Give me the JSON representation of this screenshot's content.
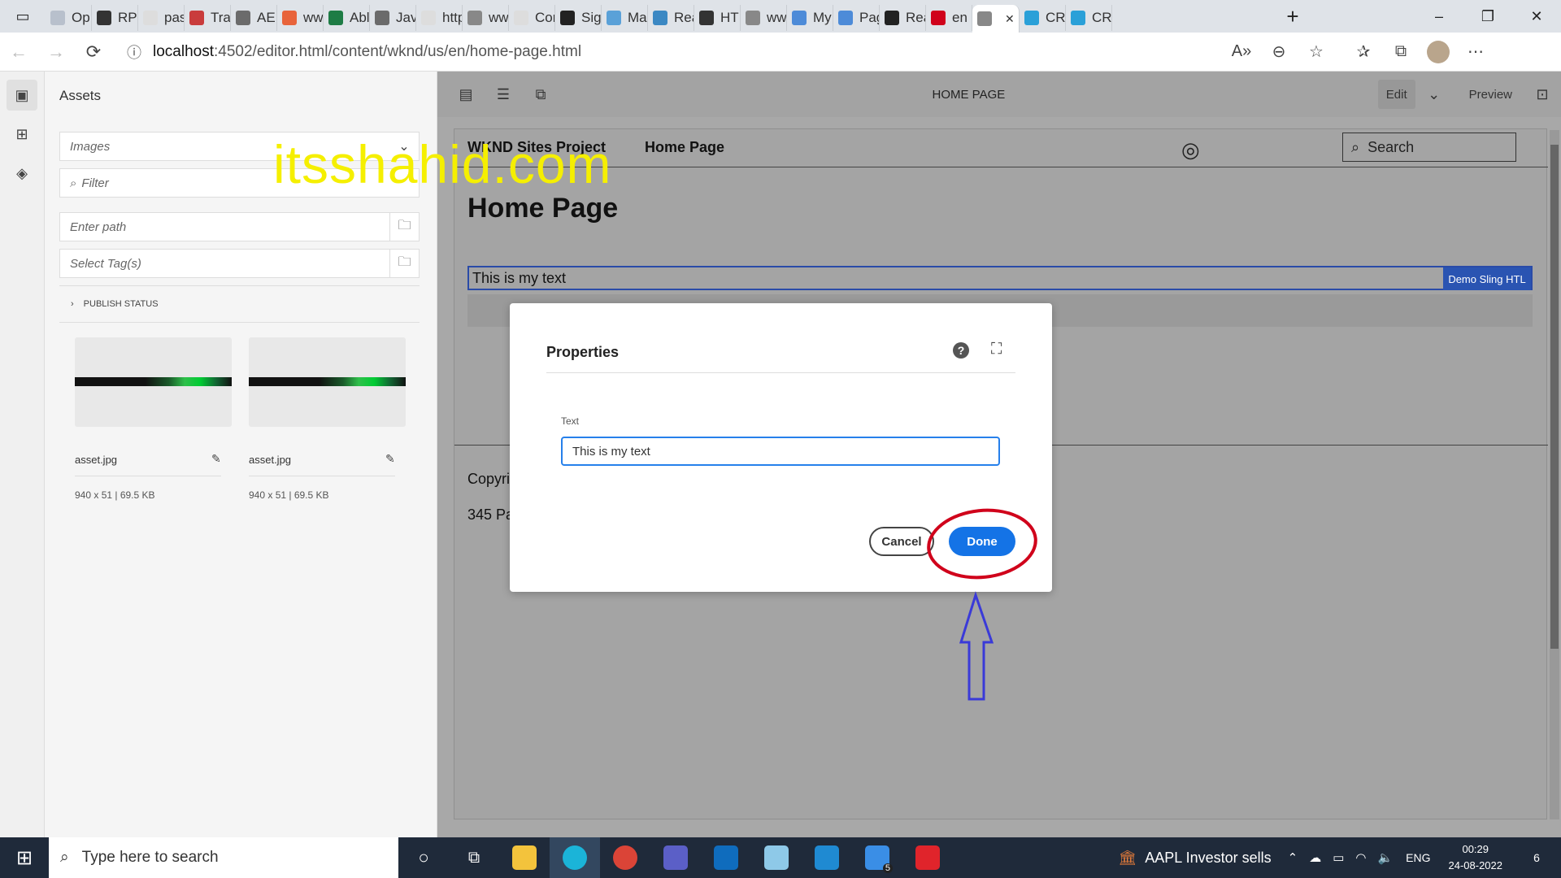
{
  "browser": {
    "tabs": [
      "Op",
      "RP-",
      "pas",
      "Trai",
      "AEN",
      "ww",
      "Abl",
      "Jav",
      "http",
      "ww",
      "Cor",
      "Sig",
      "Ma",
      "Rea",
      "HTI",
      "ww",
      "My",
      "Pag",
      "Rea",
      "en",
      "",
      "CR",
      "CR"
    ],
    "url_prefix": "localhost",
    "url_rest": ":4502/editor.html/content/wknd/us/en/home-page.html"
  },
  "assets_panel": {
    "title": "Assets",
    "type_select": "Images",
    "filter_placeholder": "Filter",
    "path_placeholder": "Enter path",
    "tags_placeholder": "Select Tag(s)",
    "publish_status": "PUBLISH STATUS",
    "items": [
      {
        "name": "asset.jpg",
        "meta": "940 x 51 | 69.5 KB"
      },
      {
        "name": "asset.jpg",
        "meta": "940 x 51 | 69.5 KB"
      }
    ]
  },
  "watermark": "itsshahid.com",
  "editor": {
    "page_title": "HOME PAGE",
    "mode": "Edit",
    "preview": "Preview"
  },
  "page": {
    "brand": "WKND Sites Project",
    "nav_item": "Home Page",
    "search_placeholder": "Search",
    "heading": "Home Page",
    "text_component": "This is my text",
    "component_label": "Demo Sling HTL",
    "footer_line1": "Copyri",
    "footer_line2": "345 Pa"
  },
  "dialog": {
    "title": "Properties",
    "field_label": "Text",
    "field_value": "This is my text",
    "cancel": "Cancel",
    "done": "Done"
  },
  "taskbar": {
    "search_placeholder": "Type here to search",
    "news": "AAPL  Investor sells",
    "lang": "ENG",
    "time": "00:29",
    "date": "24-08-2022",
    "notifications": "6",
    "mail_badge": "5"
  },
  "colors": {
    "accent_blue": "#1473e6",
    "annotation_red": "#d0021b",
    "annotation_arrow": "#3a3ad8",
    "watermark": "#f5ef00"
  }
}
